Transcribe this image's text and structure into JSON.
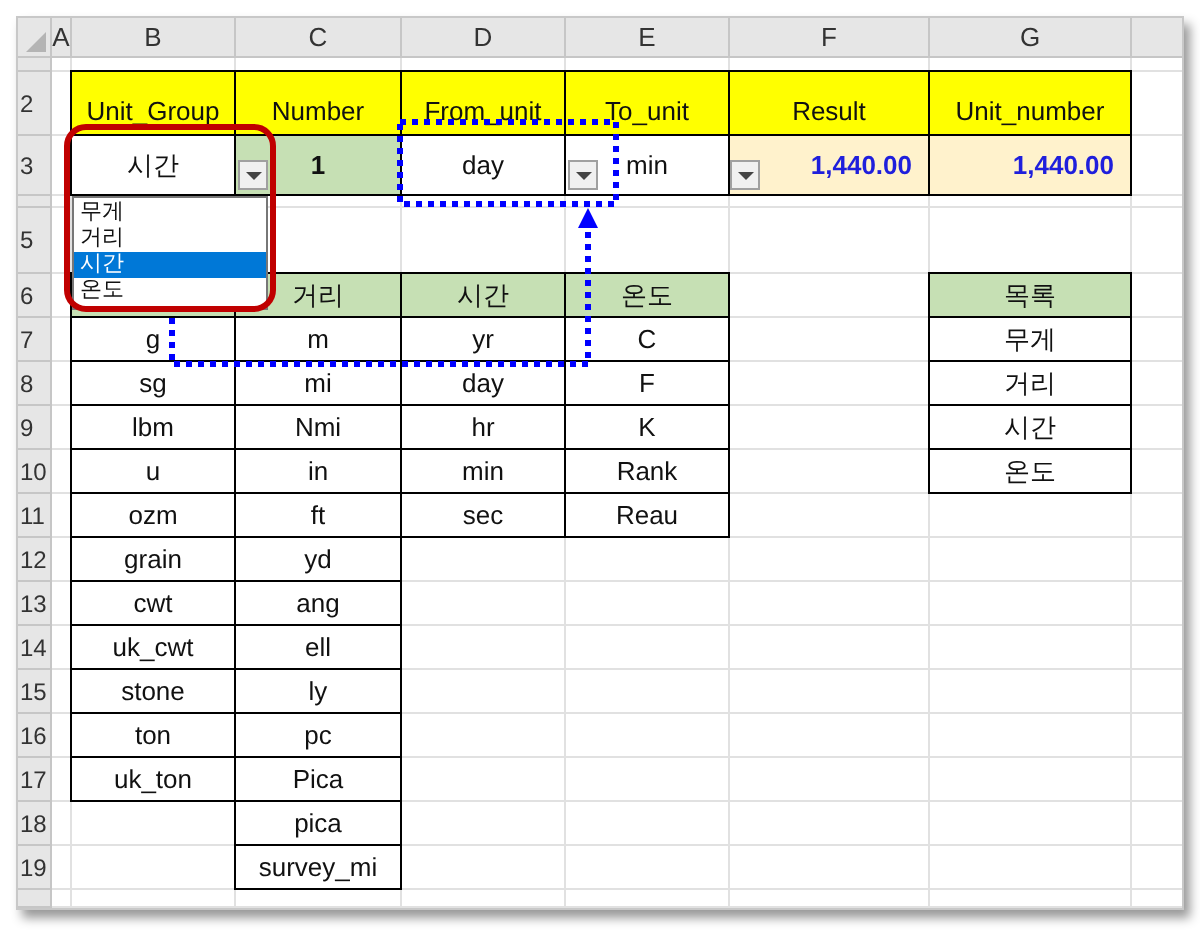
{
  "column_headers": [
    "A",
    "B",
    "C",
    "D",
    "E",
    "F",
    "G"
  ],
  "row_headers": [
    "2",
    "3",
    "5",
    "6",
    "7",
    "8",
    "9",
    "10",
    "11",
    "12",
    "13",
    "14",
    "15",
    "16",
    "17",
    "18",
    "19"
  ],
  "input_table": {
    "headers": [
      "Unit_Group",
      "Number",
      "From_unit",
      "To_unit",
      "Result",
      "Unit_number"
    ],
    "values": [
      {
        "text": "시간",
        "kind": "choice"
      },
      {
        "text": "1",
        "kind": "input"
      },
      {
        "text": "day",
        "kind": "choice"
      },
      {
        "text": "min",
        "kind": "choice"
      },
      {
        "text": "1,440.00",
        "kind": "result"
      },
      {
        "text": "1,440.00",
        "kind": "result"
      }
    ]
  },
  "unit_lists": [
    {
      "items": [
        "g",
        "sg",
        "lbm",
        "u",
        "ozm",
        "grain",
        "cwt",
        "uk_cwt",
        "stone",
        "ton",
        "uk_ton"
      ]
    },
    {
      "header": "거리",
      "items": [
        "m",
        "mi",
        "Nmi",
        "in",
        "ft",
        "yd",
        "ang",
        "ell",
        "ly",
        "pc",
        "Pica",
        "pica",
        "survey_mi"
      ]
    },
    {
      "header": "시간",
      "items": [
        "yr",
        "day",
        "hr",
        "min",
        "sec"
      ]
    },
    {
      "header": "온도",
      "items": [
        "C",
        "F",
        "K",
        "Rank",
        "Reau"
      ]
    }
  ],
  "category_list": {
    "header": "목록",
    "items": [
      "무게",
      "거리",
      "시간",
      "온도"
    ]
  },
  "dropdown": {
    "options": [
      {
        "label": "무게",
        "selected": false
      },
      {
        "label": "거리",
        "selected": false
      },
      {
        "label": "시간",
        "selected": true
      },
      {
        "label": "온도",
        "selected": false
      }
    ]
  }
}
